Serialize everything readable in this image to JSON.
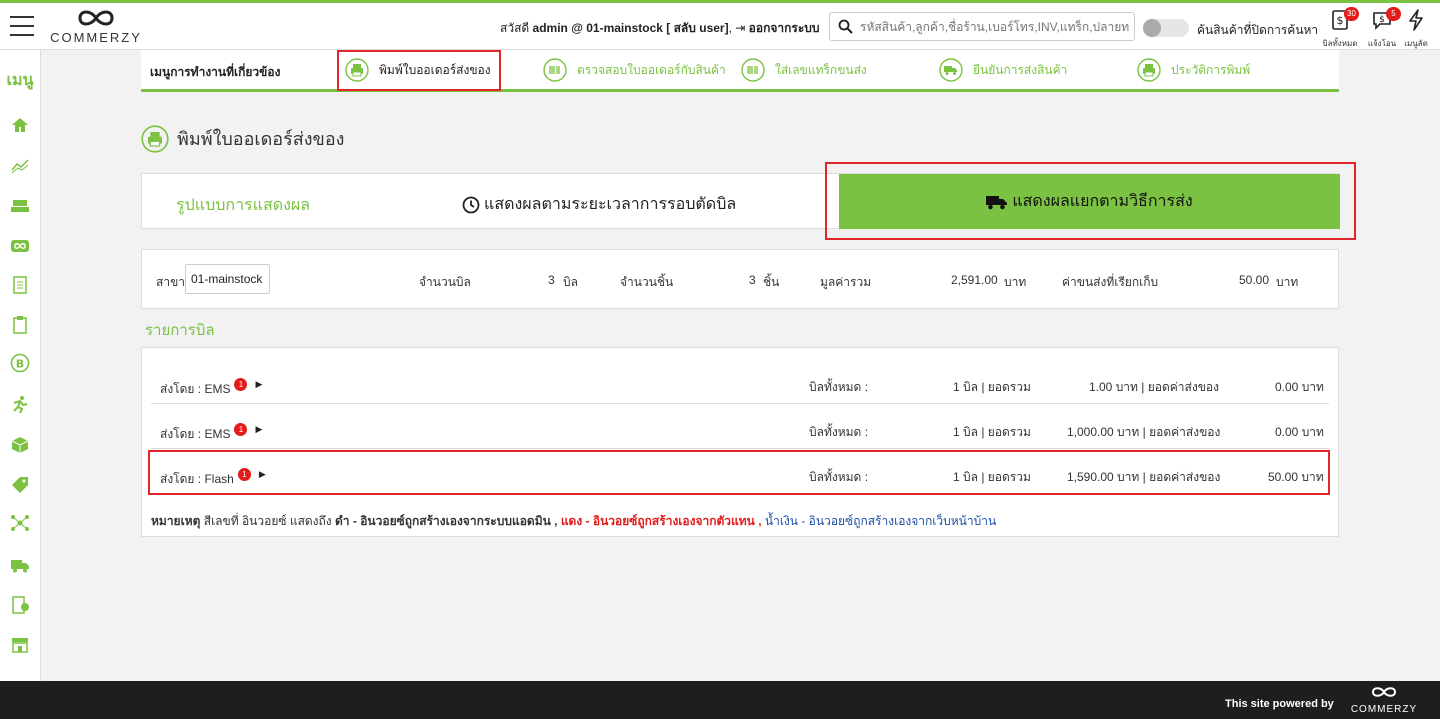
{
  "header": {
    "logo_text": "COMMERZY",
    "greeting_prefix": "สวัสดี",
    "user": "admin @ 01-mainstock",
    "switch_user": "[ สลับ user]",
    "logout": "ออกจากระบบ",
    "search_placeholder": "รหัสสินค้า,ลูกค้า,ชื่อร้าน,เบอร์โทร,INV,แทร็ก,ปลายทาง",
    "toggle_label": "ค้นสินค้าที่ปิดการค้นหา",
    "icons": [
      {
        "label": "บิลทั้งหมด",
        "badge": "30"
      },
      {
        "label": "แจ้งโอน",
        "badge": "5"
      },
      {
        "label": "เมนูลัด",
        "badge": ""
      }
    ]
  },
  "sidebar": {
    "title": "เมนู"
  },
  "menu": {
    "heading": "เมนูการทำงานที่เกี่ยวข้อง",
    "items": [
      {
        "label": "พิมพ์ใบออเดอร์ส่งของ"
      },
      {
        "label": "ตรวจสอบใบออเดอร์กับสินค้า"
      },
      {
        "label": "ใส่เลขแทร็กขนส่ง"
      },
      {
        "label": "ยืนยันการส่งสินค้า"
      },
      {
        "label": "ประวัติการพิมพ์"
      }
    ]
  },
  "page": {
    "title": "พิมพ์ใบออเดอร์ส่งของ"
  },
  "display_mode": {
    "label": "รูปแบบการแสดงผล",
    "option_time": "แสดงผลตามระยะเวลาการรอบตัดบิล",
    "option_ship": "แสดงผลแยกตามวิธีการส่ง"
  },
  "summary": {
    "branch_label": "สาขา",
    "branch_value": "01-mainstock",
    "bill_count_label": "จำนวนบิล",
    "bill_count_value": "3",
    "bill_unit": "บิล",
    "piece_count_label": "จำนวนชิ้น",
    "piece_count_value": "3",
    "piece_unit": "ชิ้น",
    "total_label": "มูลค่ารวม",
    "total_value": "2,591.00",
    "baht": "บาท",
    "shipping_label": "ค่าขนส่งที่เรียกเก็บ",
    "shipping_value": "50.00"
  },
  "bills": {
    "section_title": "รายการบิล",
    "rows": [
      {
        "ship_by": "ส่งโดย : EMS",
        "badge": "1",
        "all_bills_label": "บิลทั้งหมด :",
        "count": "1 บิล | ยอดรวม",
        "amount": "1.00 บาท | ยอดค่าส่งของ",
        "shipping": "0.00 บาท"
      },
      {
        "ship_by": "ส่งโดย : EMS",
        "badge": "1",
        "all_bills_label": "บิลทั้งหมด :",
        "count": "1 บิล | ยอดรวม",
        "amount": "1,000.00 บาท | ยอดค่าส่งของ",
        "shipping": "0.00 บาท"
      },
      {
        "ship_by": "ส่งโดย : Flash",
        "badge": "1",
        "all_bills_label": "บิลทั้งหมด :",
        "count": "1 บิล | ยอดรวม",
        "amount": "1,590.00 บาท | ยอดค่าส่งของ",
        "shipping": "50.00 บาท"
      }
    ],
    "note": {
      "prefix": "หมายเหตุ",
      "text": " สีเลขที่ อินวอยซ์ แสดงถึง ",
      "black": "ดำ - อินวอยซ์ถูกสร้างเองจากระบบแอดมิน ,",
      "red": " แดง - อินวอยซ์ถูกสร้างเองจากตัวแทน ,",
      "blue": " น้ำเงิน - อินวอยซ์ถูกสร้างเองจากเว็บหน้าบ้าน"
    }
  },
  "footer": {
    "powered": "This site powered by",
    "logo_text": "COMMERZY"
  },
  "colors": {
    "accent": "#7cc242",
    "highlight": "#e0252b",
    "badge": "#e21b1b",
    "note_red": "#e21b1b",
    "note_blue": "#1f4fa8"
  }
}
